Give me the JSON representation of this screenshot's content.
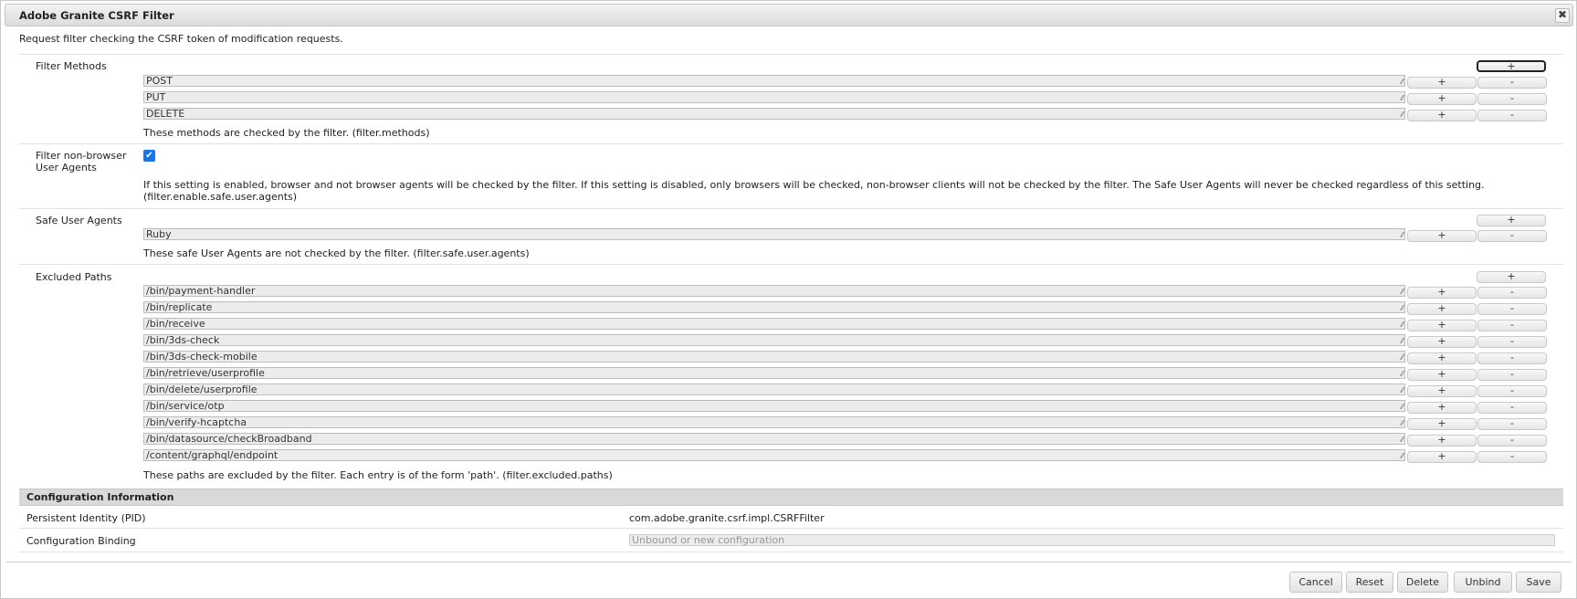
{
  "dialog": {
    "title": "Adobe Granite CSRF Filter",
    "close_glyph": "✖",
    "description": "Request filter checking the CSRF token of modification requests."
  },
  "filter_methods": {
    "label": "Filter Methods",
    "values": [
      "POST",
      "PUT",
      "DELETE"
    ],
    "help": "These methods are checked by the filter. (filter.methods)"
  },
  "non_browser": {
    "label_line1": "Filter non-browser",
    "label_line2": "User Agents",
    "checked": true,
    "check_glyph": "✔",
    "help_line1": "If this setting is enabled, browser and not browser agents will be checked by the filter. If this setting is disabled, only browsers will be checked, non-browser clients will not be checked by the filter. The Safe User Agents will never be checked regardless of this setting.",
    "help_line2": "(filter.enable.safe.user.agents)"
  },
  "safe_agents": {
    "label": "Safe User Agents",
    "values": [
      "Ruby"
    ],
    "help": "These safe User Agents are not checked by the filter. (filter.safe.user.agents)"
  },
  "excluded_paths": {
    "label": "Excluded Paths",
    "values": [
      "/bin/payment-handler",
      "/bin/replicate",
      "/bin/receive",
      "/bin/3ds-check",
      "/bin/3ds-check-mobile",
      "/bin/retrieve/userprofile",
      "/bin/delete/userprofile",
      "/bin/service/otp",
      "/bin/verify-hcaptcha",
      "/bin/datasource/checkBroadband",
      "/content/graphql/endpoint"
    ],
    "help": "These paths are excluded by the filter. Each entry is of the form 'path'. (filter.excluded.paths)"
  },
  "buttons": {
    "add": "+",
    "remove": "-"
  },
  "config_info": {
    "header": "Configuration Information",
    "pid_label": "Persistent Identity (PID)",
    "pid_value": "com.adobe.granite.csrf.impl.CSRFFilter",
    "binding_label": "Configuration Binding",
    "binding_value": "Unbound or new configuration"
  },
  "footer": {
    "cancel": "Cancel",
    "reset": "Reset",
    "delete": "Delete",
    "unbind": "Unbind",
    "save": "Save"
  }
}
